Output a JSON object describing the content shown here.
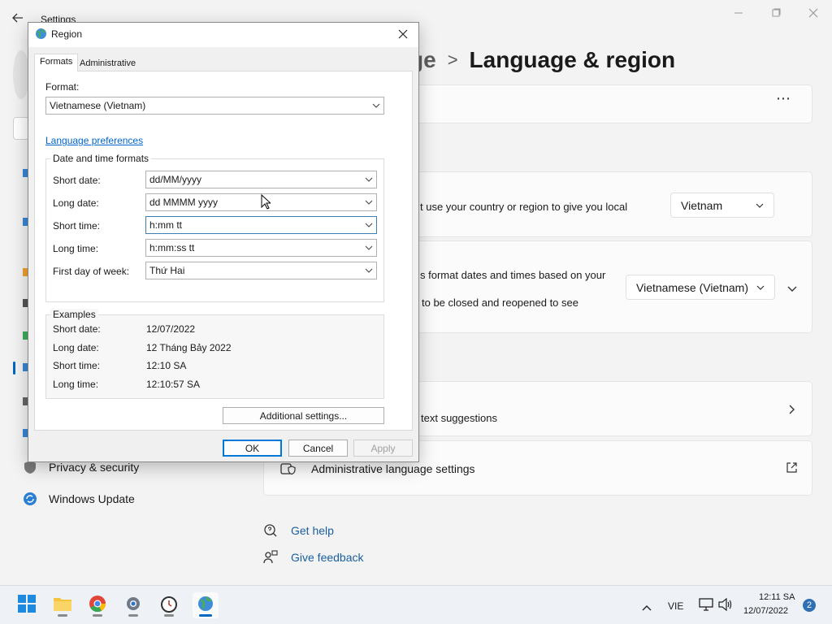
{
  "settings": {
    "title": "Settings",
    "breadcrumb_prev": "ge",
    "breadcrumb_sep": ">",
    "breadcrumb_current": "Language & region",
    "more_icon": "⋯",
    "region_card_text": "t use your country or region to give you local",
    "country_value": "Vietnam",
    "format_card_line1": "s format dates and times based on your",
    "format_card_line2": "to be closed and reopened to see",
    "regional_format_value": "Vietnamese (Vietnam)",
    "typing_card_text": "text suggestions",
    "admin_lang_label": "Administrative language settings",
    "get_help": "Get help",
    "give_feedback": "Give feedback",
    "nav_privacy": "Privacy & security",
    "nav_update": "Windows Update"
  },
  "dialog": {
    "title": "Region",
    "close": "✕",
    "tabs": {
      "formats": "Formats",
      "administrative": "Administrative"
    },
    "format_label": "Format:",
    "format_value": "Vietnamese (Vietnam)",
    "language_prefs_link": "Language preferences",
    "dt_group_title": "Date and time formats",
    "fields": {
      "short_date_label": "Short date:",
      "short_date_value": "dd/MM/yyyy",
      "long_date_label": "Long date:",
      "long_date_value": "dd MMMM yyyy",
      "short_time_label": "Short time:",
      "short_time_value": "h:mm tt",
      "long_time_label": "Long time:",
      "long_time_value": "h:mm:ss tt",
      "first_day_label": "First day of week:",
      "first_day_value": "Thứ Hai"
    },
    "examples": {
      "title": "Examples",
      "short_date_label": "Short date:",
      "short_date_value": "12/07/2022",
      "long_date_label": "Long date:",
      "long_date_value": "12 Tháng Bảy 2022",
      "short_time_label": "Short time:",
      "short_time_value": "12:10 SA",
      "long_time_label": "Long time:",
      "long_time_value": "12:10:57 SA"
    },
    "additional_settings": "Additional settings...",
    "ok": "OK",
    "cancel": "Cancel",
    "apply": "Apply"
  },
  "taskbar": {
    "language": "VIE",
    "time": "12:11 SA",
    "date": "12/07/2022",
    "notification_count": "2"
  },
  "colors": {
    "accent": "#0067c0",
    "link": "#0066cc"
  }
}
